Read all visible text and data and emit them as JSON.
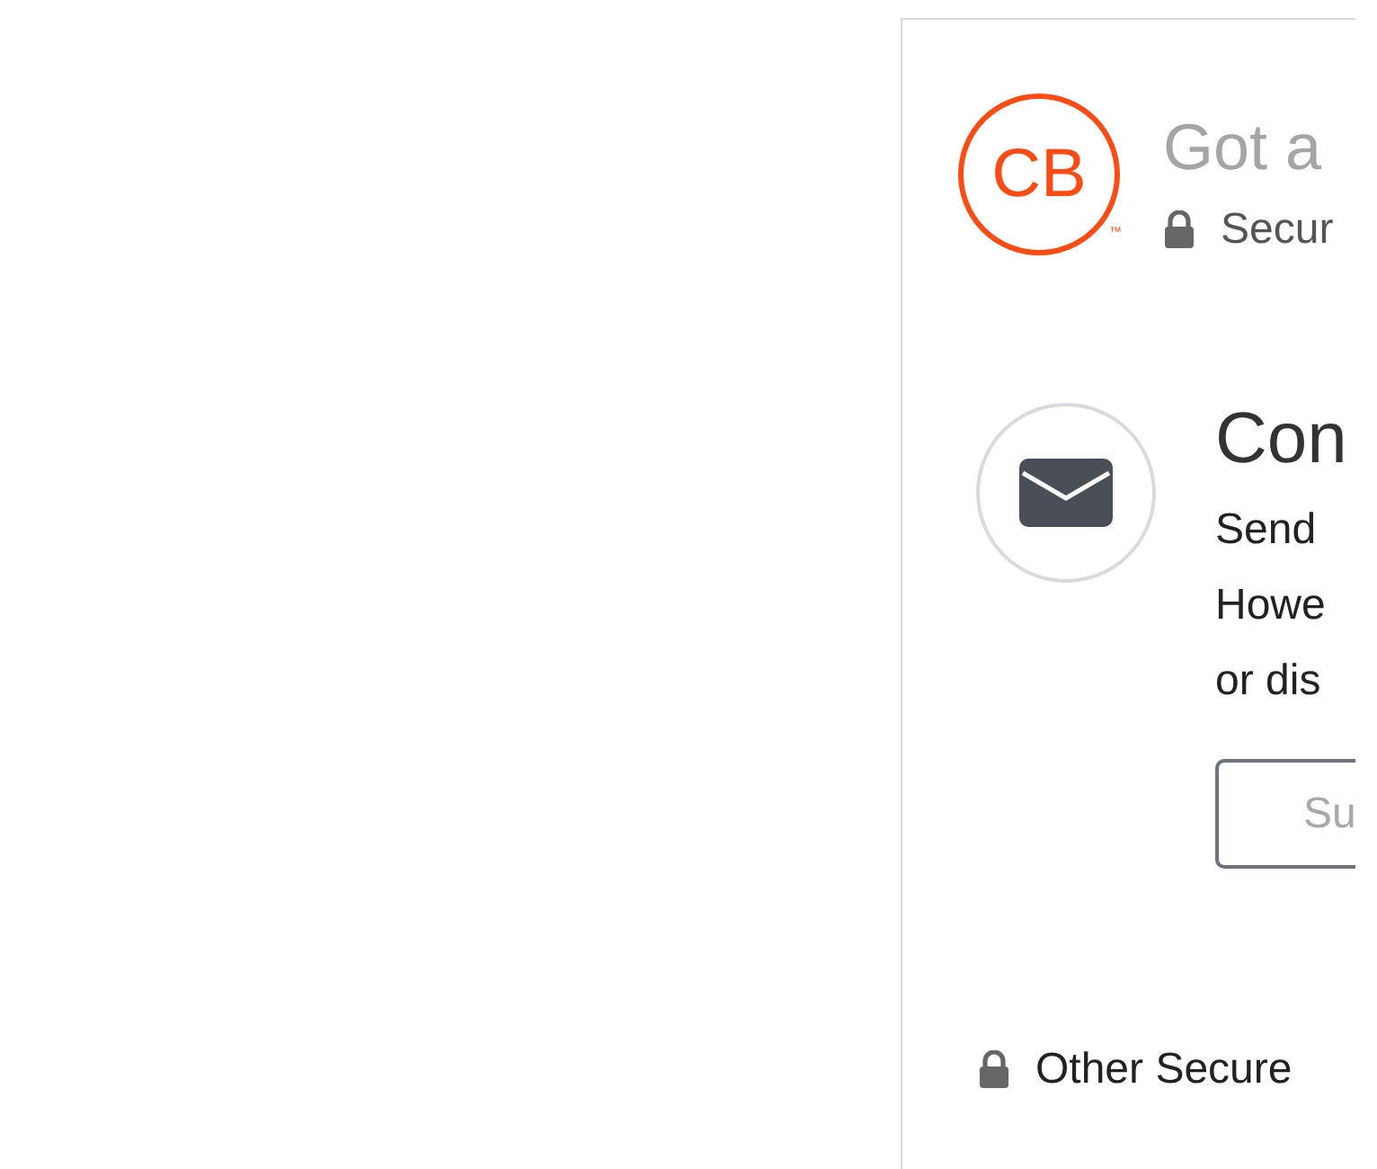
{
  "header": {
    "logo": {
      "text": "CB",
      "mark": "™"
    },
    "title": "Got a",
    "secure_note": "Secur"
  },
  "contact": {
    "title": "Con",
    "lines": [
      "Send",
      "Howe",
      "or dis"
    ],
    "button": "Su"
  },
  "footer": {
    "text": "Other Secure"
  }
}
